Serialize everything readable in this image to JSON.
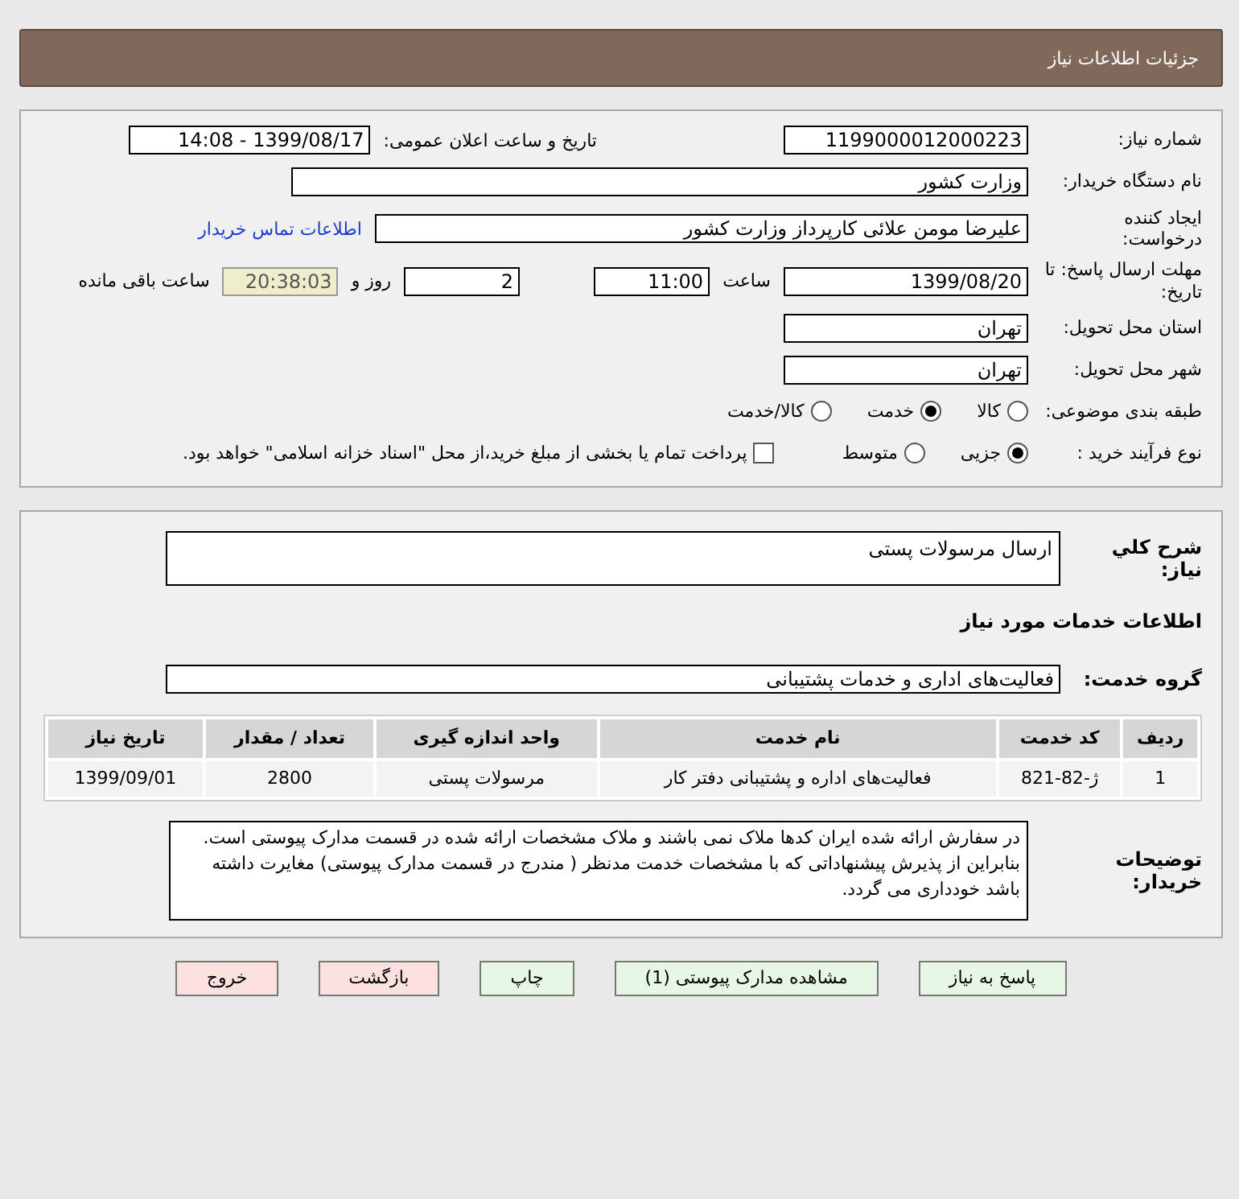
{
  "header": {
    "title": "جزئیات اطلاعات نیاز"
  },
  "details": {
    "need_number": {
      "label": "شماره نیاز:",
      "value": "1199000012000223"
    },
    "announce": {
      "label": "تاریخ و ساعت اعلان عمومی:",
      "value": "1399/08/17 - 14:08"
    },
    "buyer": {
      "label": "نام دستگاه خریدار:",
      "value": "وزارت کشور"
    },
    "creator": {
      "label": "ایجاد کننده درخواست:",
      "value": "علیرضا مومن علائی کارپرداز وزارت کشور",
      "link": "اطلاعات تماس خریدار"
    },
    "deadline": {
      "label": "مهلت ارسال پاسخ: تا تاریخ:",
      "date": "1399/08/20",
      "time_label": "ساعت",
      "time": "11:00",
      "days": "2",
      "days_label": "روز و",
      "remaining": "20:38:03",
      "remaining_label": "ساعت باقی مانده"
    },
    "province": {
      "label": "استان محل تحویل:",
      "value": "تهران"
    },
    "city": {
      "label": "شهر محل تحویل:",
      "value": "تهران"
    },
    "category": {
      "label": "طبقه بندی موضوعی:",
      "options": [
        {
          "label": "کالا",
          "selected": false
        },
        {
          "label": "خدمت",
          "selected": true
        },
        {
          "label": "کالا/خدمت",
          "selected": false
        }
      ]
    },
    "process": {
      "label": "نوع فرآیند خرید :",
      "options": [
        {
          "label": "جزیی",
          "selected": true
        },
        {
          "label": "متوسط",
          "selected": false
        }
      ],
      "payment": {
        "label": "پرداخت تمام یا بخشی از مبلغ خرید،از محل \"اسناد خزانه اسلامی\" خواهد بود.",
        "checked": false
      }
    }
  },
  "summary": {
    "label": "شرح کلي نياز:",
    "value": "ارسال مرسولات پستی"
  },
  "services_title": "اطلاعات خدمات مورد نياز",
  "service_group": {
    "label": "گروه خدمت:",
    "value": "فعالیت‌های اداری و خدمات پشتیبانی"
  },
  "table": {
    "columns": [
      "ردیف",
      "کد خدمت",
      "نام خدمت",
      "واحد اندازه گیری",
      "تعداد / مقدار",
      "تاریخ نیاز"
    ],
    "rows": [
      [
        "1",
        "ژ-82-821",
        "فعالیت‌های اداره و پشتیبانی دفتر کار",
        "مرسولات پستی",
        "2800",
        "1399/09/01"
      ]
    ]
  },
  "notes": {
    "label": "توضیحات خریدار:",
    "value": "در سفارش ارائه شده ایران کدها ملاک نمی باشند و ملاک مشخصات ارائه شده در قسمت مدارک پیوستی است. بنابراین از پذیرش پیشنهاداتی که با مشخصات خدمت مدنظر ( مندرج در قسمت مدارک پیوستی) مغایرت داشته باشد خودداری می گردد."
  },
  "buttons": [
    {
      "label": "پاسخ به نیاز",
      "kind": "normal"
    },
    {
      "label": "مشاهده مدارک پیوستی (1)",
      "kind": "normal"
    },
    {
      "label": "چاپ",
      "kind": "normal"
    },
    {
      "label": "بازگشت",
      "kind": "danger"
    },
    {
      "label": "خروج",
      "kind": "danger"
    }
  ]
}
